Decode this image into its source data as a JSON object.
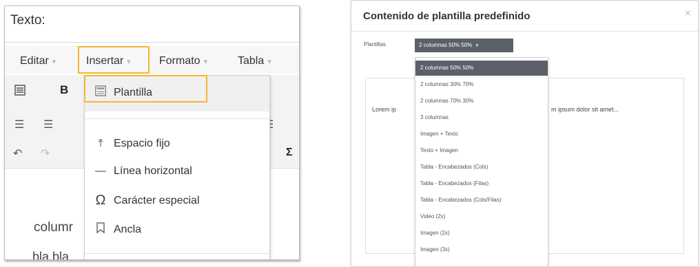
{
  "left": {
    "label": "Texto:",
    "menus": [
      "Editar",
      "Insertar",
      "Formato",
      "Tabla"
    ],
    "insert_menu": {
      "template": "Plantilla",
      "items": [
        "Espacio fijo",
        "Línea horizontal",
        "Carácter especial",
        "Ancla"
      ]
    },
    "editor_lines": [
      "columr",
      "bla bla"
    ]
  },
  "dialog": {
    "title": "Contenido de plantilla predefinido",
    "close": "×",
    "templates_label": "Plantillas",
    "selected": "2 columnas 50% 50%",
    "options": [
      "2 columnas 50% 50%",
      "2 columnas 30% 70%",
      "2 columnas 70% 30%",
      "3 columnas",
      "Imagen + Texto",
      "Texto + Imagen",
      "Tabla - Encabezados (Cols)",
      "Tabla - Encabezados (Filas)",
      "Tabla - Encabezados (Cols/Filas)",
      "Video (2x)",
      "Imagen (2x)",
      "Imagen (3x)"
    ],
    "preview_left": "Lorem ip",
    "preview_right": "m ipsum dolor sit amet..."
  },
  "colors": {
    "highlight": "#f5b82e",
    "select_bg": "#5b6069"
  }
}
